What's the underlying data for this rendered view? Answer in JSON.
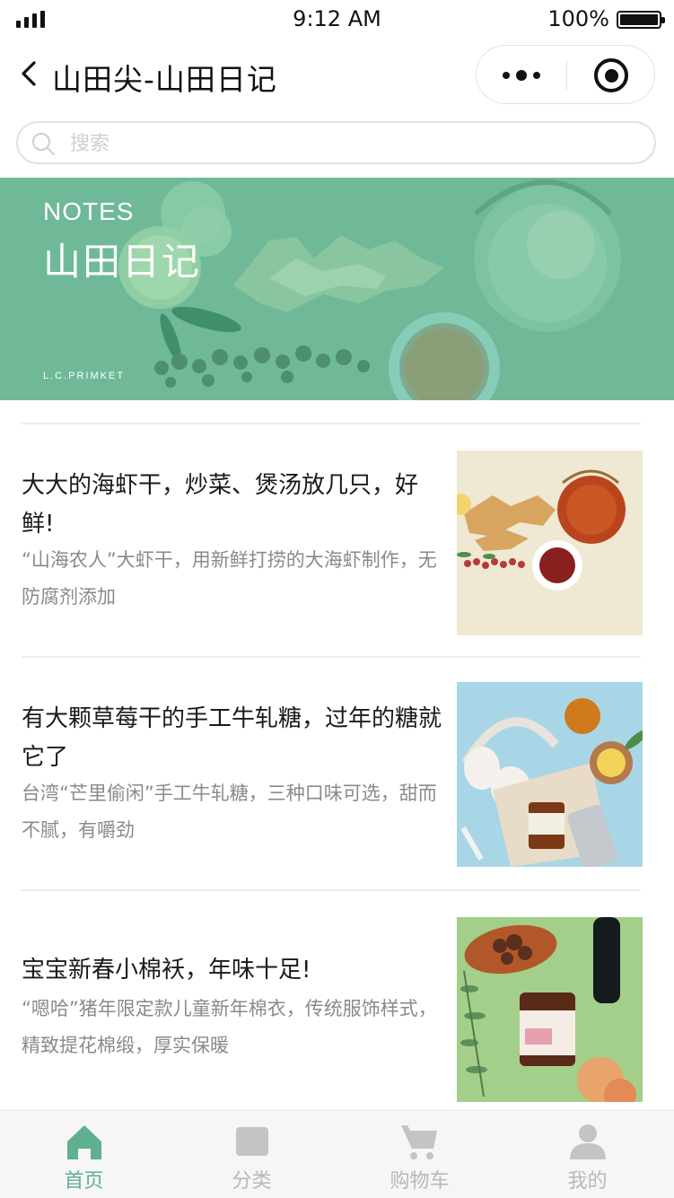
{
  "status_bar": {
    "time": "9:12 AM",
    "battery": "100%"
  },
  "nav": {
    "title": "山田尖-山田日记"
  },
  "search": {
    "placeholder": "搜索"
  },
  "banner": {
    "kicker": "NOTES",
    "title": "山田日记",
    "brand": "L.C.PRIMKET"
  },
  "articles": [
    {
      "title": "大大的海虾干，炒菜、煲汤放几只，好鲜!",
      "desc": "“山海农人”大虾干，用新鲜打捞的大海虾制作，无防腐剂添加"
    },
    {
      "title": "有大颗草莓干的手工牛轧糖，过年的糖就它了",
      "desc": "台湾“芒里偷闲”手工牛轧糖，三种口味可选，甜而不腻，有嚼劲"
    },
    {
      "title": "宝宝新春小棉袄，年味十足!",
      "desc": "“嗯哈”猪年限定款儿童新年棉衣，传统服饰样式，精致提花棉缎，厚实保暖"
    }
  ],
  "tabs": [
    {
      "label": "首页",
      "icon": "home-icon",
      "active": true
    },
    {
      "label": "分类",
      "icon": "category-icon",
      "active": false
    },
    {
      "label": "购物车",
      "icon": "cart-icon",
      "active": false
    },
    {
      "label": "我的",
      "icon": "user-icon",
      "active": false
    }
  ],
  "colors": {
    "accent": "#5fb08e",
    "banner": "#6fb999",
    "inactive": "#b8b8b8"
  }
}
